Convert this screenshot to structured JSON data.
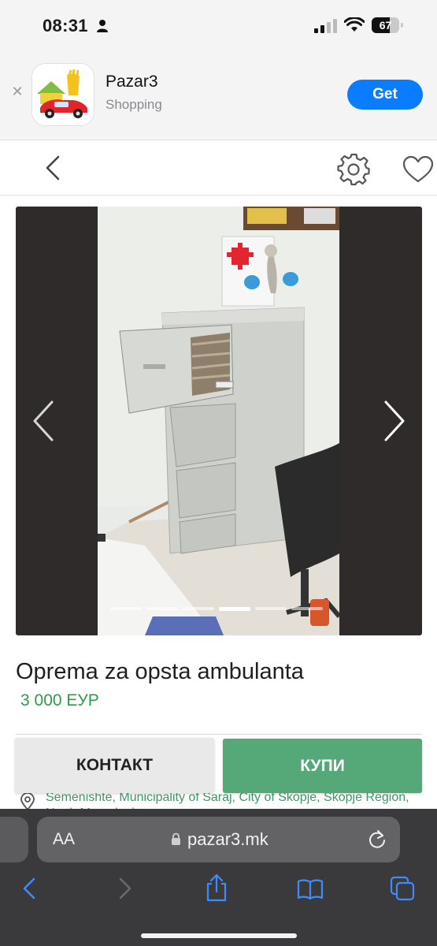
{
  "status_bar": {
    "time": "08:31",
    "battery": "67",
    "battery_level": 0.67
  },
  "app_banner": {
    "app_name": "Pazar3",
    "category": "Shopping",
    "get_label": "Get"
  },
  "gallery": {
    "image_count": 6,
    "active_index": 3
  },
  "listing": {
    "title": "Oprema za opsta ambulanta",
    "price": "3 000 ЕУР",
    "location": "Semenishte, Municipality of Saraj, City of Skopje, Skopje Region, North Macedonia"
  },
  "actions": {
    "contact_label": "КОНТАКТ",
    "buy_label": "КУПИ"
  },
  "browser": {
    "aa_label": "AA",
    "url": "pazar3.mk"
  },
  "colors": {
    "accent_blue": "#0a7cff",
    "price_green": "#2f9a4a",
    "buy_green": "#55a978",
    "safari_chrome": "#3a3a3c"
  },
  "icons": [
    "person-icon",
    "signal-icon",
    "wifi-icon",
    "close-icon",
    "back-icon",
    "gear-icon",
    "heart-icon",
    "chevron-left-icon",
    "chevron-right-icon",
    "location-pin-icon",
    "lock-icon",
    "reload-icon",
    "share-icon",
    "bookmarks-icon",
    "tabs-icon"
  ]
}
